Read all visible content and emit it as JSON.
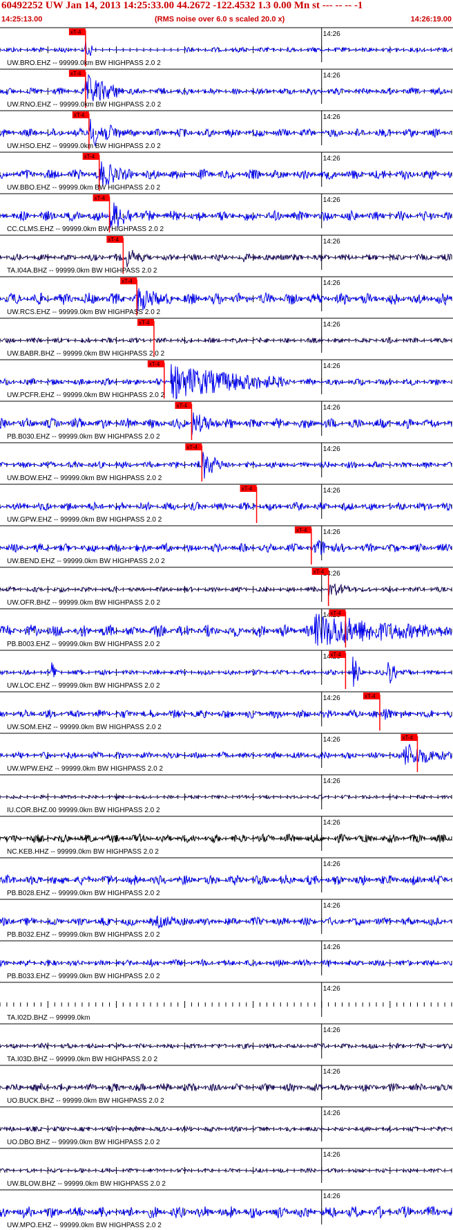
{
  "header": {
    "title": "60492252 UW Jan 14, 2013 14:25:33.00   44.2672 -122.4532  1.3 0.00 Mn st --- -- --  -1",
    "start_time": "14:25:13.00",
    "rms_note": "(RMS noise over 6.0 s scaled 20.0 x)",
    "end_time": "14:26:19.00"
  },
  "colors": {
    "header": "#cc0000",
    "trace_blue": "#0000ee",
    "trace_dark": "#1a0a5a",
    "trace_black": "#000000",
    "pick": "#ff0000"
  },
  "chart_data": {
    "type": "line",
    "x_start": "14:25:13.00",
    "x_end": "14:26:19.00",
    "minute_label": "14:26",
    "minute_mark": "14:26:00",
    "pick_label": "xT-4",
    "channels": [
      {
        "label": "UW.BRO.EHZ -- 99999.0km BW  HIGHPASS  2.0  2",
        "color": "blue",
        "pick": "14:25:25.5",
        "noise": 0.15,
        "events": [
          {
            "t": "14:25:25.5",
            "dur": 1.0,
            "amp": 1.0
          }
        ],
        "flat": [
          "14:25:26.5",
          "14:25:40.0"
        ]
      },
      {
        "label": "UW.RNO.EHZ -- 99999.0km BW  HIGHPASS  2.0  2",
        "color": "blue",
        "pick": "14:25:25.5",
        "noise": 0.2,
        "events": [
          {
            "t": "14:25:25.5",
            "dur": 5.5,
            "amp": 1.0
          }
        ]
      },
      {
        "label": "UW.HSO.EHZ -- 99999.0km BW  HIGHPASS  2.0  2",
        "color": "blue",
        "pick": "14:25:26.0",
        "noise": 0.25,
        "events": [
          {
            "t": "14:25:26.0",
            "dur": 5.0,
            "amp": 0.95
          }
        ]
      },
      {
        "label": "UW.BBO.EHZ -- 99999.0km BW  HIGHPASS  2.0  2",
        "color": "blue",
        "pick": "14:25:27.5",
        "noise": 0.3,
        "events": [
          {
            "t": "14:25:27.5",
            "dur": 4.0,
            "amp": 0.9
          }
        ]
      },
      {
        "label": "CC.CLMS.EHZ -- 99999.0km BW  HIGHPASS  2.0  2",
        "color": "blue",
        "pick": "14:25:29.0",
        "noise": 0.3,
        "events": [
          {
            "t": "14:25:29.0",
            "dur": 4.0,
            "amp": 1.0
          }
        ]
      },
      {
        "label": "TA.I04A.BHZ -- 99999.0km BW  HIGHPASS  2.0  2",
        "color": "dark",
        "pick": "14:25:31.0",
        "noise": 0.2,
        "events": [
          {
            "t": "14:25:31.5",
            "dur": 3.0,
            "amp": 0.6
          },
          {
            "t": "14:25:48.5",
            "dur": 2.5,
            "amp": 0.35
          },
          {
            "t": "14:25:53.5",
            "dur": 2.0,
            "amp": 0.3
          }
        ]
      },
      {
        "label": "UW.RCS.EHZ -- 99999.0km BW  HIGHPASS  2.0  2",
        "color": "blue",
        "pick": "14:25:33.0",
        "noise": 0.35,
        "events": [
          {
            "t": "14:25:33.0",
            "dur": 5.0,
            "amp": 0.8
          }
        ]
      },
      {
        "label": "UW.BABR.BHZ -- 99999.0km BW  HIGHPASS  2.0  2",
        "color": "dark",
        "pick": "14:25:35.5",
        "noise": 0.15,
        "events": []
      },
      {
        "label": "UW.PCFR.EHZ -- 99999.0km BW  HIGHPASS  2.0  2",
        "color": "blue",
        "pick": "14:25:37.0",
        "noise": 0.2,
        "events": [
          {
            "t": "14:25:38.0",
            "dur": 17.0,
            "amp": 1.0
          }
        ]
      },
      {
        "label": "PB.B030.EHZ -- 99999.0km BW  HIGHPASS  2.0  2",
        "color": "blue",
        "pick": "14:25:41.0",
        "noise": 0.3,
        "events": [
          {
            "t": "14:25:41.0",
            "dur": 4.0,
            "amp": 0.75
          }
        ]
      },
      {
        "label": "UW.BOW.EHZ -- 99999.0km BW  HIGHPASS  2.0  2",
        "color": "blue",
        "pick": "14:25:42.5",
        "noise": 0.2,
        "events": [
          {
            "t": "14:25:42.5",
            "dur": 3.0,
            "amp": 0.9
          }
        ]
      },
      {
        "label": "UW.GPW.EHZ -- 99999.0km BW  HIGHPASS  2.0  2",
        "color": "blue",
        "pick": "14:25:50.5",
        "noise": 0.25,
        "events": []
      },
      {
        "label": "UW.BEND.EHZ -- 99999.0km BW  HIGHPASS  2.0  2",
        "color": "blue",
        "pick": "14:25:58.5",
        "noise": 0.25,
        "events": [
          {
            "t": "14:25:59.0",
            "dur": 4.0,
            "amp": 0.6
          }
        ]
      },
      {
        "label": "UW.OFR.BHZ -- 99999.0km BW  HIGHPASS  2.0  2",
        "color": "dark",
        "pick": "14:26:01.0",
        "noise": 0.15,
        "events": [
          {
            "t": "14:26:01.0",
            "dur": 4.0,
            "amp": 0.5
          }
        ]
      },
      {
        "label": "PB.B003.EHZ -- 99999.0km BW  HIGHPASS  2.0  2",
        "color": "blue",
        "pick": "14:26:03.5",
        "noise": 0.35,
        "events": [
          {
            "t": "14:25:59.0",
            "dur": 20.0,
            "amp": 1.0
          }
        ]
      },
      {
        "label": "UW.LOC.EHZ -- 99999.0km BW  HIGHPASS  2.0  2",
        "color": "blue",
        "pick": "14:26:03.5",
        "noise": 0.15,
        "events": [
          {
            "t": "14:25:20.5",
            "dur": 1.0,
            "amp": 0.9
          },
          {
            "t": "14:26:04.5",
            "dur": 1.5,
            "amp": 1.0
          },
          {
            "t": "14:26:09.5",
            "dur": 1.5,
            "amp": 1.0
          }
        ]
      },
      {
        "label": "UW.SOM.EHZ -- 99999.0km BW  HIGHPASS  2.0  2",
        "color": "blue",
        "pick": "14:26:08.5",
        "noise": 0.25,
        "events": [
          {
            "t": "14:26:09.0",
            "dur": 2.0,
            "amp": 0.5
          }
        ]
      },
      {
        "label": "UW.WPW.EHZ -- 99999.0km BW  HIGHPASS  2.0  2",
        "color": "blue",
        "pick": "14:26:14.0",
        "noise": 0.2,
        "events": [
          {
            "t": "14:26:12.0",
            "dur": 6.0,
            "amp": 0.8
          }
        ]
      },
      {
        "label": "IU.COR.BHZ.00 99999.0km BW  HIGHPASS  2.0  2",
        "color": "dark",
        "pick": null,
        "noise": 0.1,
        "events": []
      },
      {
        "label": "NC.KEB.HHZ -- 99999.0km BW  HIGHPASS  2.0  2",
        "color": "black",
        "pick": null,
        "noise": 0.25,
        "events": []
      },
      {
        "label": "PB.B028.EHZ -- 99999.0km BW  HIGHPASS  2.0  2",
        "color": "blue",
        "pick": null,
        "noise": 0.3,
        "events": []
      },
      {
        "label": "PB.B032.EHZ -- 99999.0km BW  HIGHPASS  2.0  2",
        "color": "blue",
        "pick": null,
        "noise": 0.25,
        "events": [
          {
            "t": "14:25:36.0",
            "dur": 6.0,
            "amp": 0.4
          }
        ]
      },
      {
        "label": "PB.B033.EHZ -- 99999.0km BW  HIGHPASS  2.0  2",
        "color": "blue",
        "pick": null,
        "noise": 0.2,
        "events": []
      },
      {
        "label": "TA.I02D.BHZ -- 99999.0km",
        "color": "none",
        "pick": null,
        "noise": 0,
        "events": []
      },
      {
        "label": "TA.I03D.BHZ -- 99999.0km BW  HIGHPASS  2.0  2",
        "color": "dark",
        "pick": null,
        "noise": 0.15,
        "events": []
      },
      {
        "label": "UO.BUCK.BHZ -- 99999.0km BW  HIGHPASS  2.0  2",
        "color": "dark",
        "pick": null,
        "noise": 0.25,
        "events": []
      },
      {
        "label": "UO.DBO.BHZ -- 99999.0km BW  HIGHPASS  2.0  2",
        "color": "dark",
        "pick": null,
        "noise": 0.15,
        "events": []
      },
      {
        "label": "UW.BLOW.BHZ -- 99999.0km BW  HIGHPASS  2.0  2",
        "color": "dark",
        "pick": null,
        "noise": 0.12,
        "events": []
      },
      {
        "label": "UW.MPO.EHZ -- 99999.0km BW  HIGHPASS  2.0  2",
        "color": "blue",
        "pick": null,
        "noise": 0.35,
        "events": []
      }
    ]
  }
}
